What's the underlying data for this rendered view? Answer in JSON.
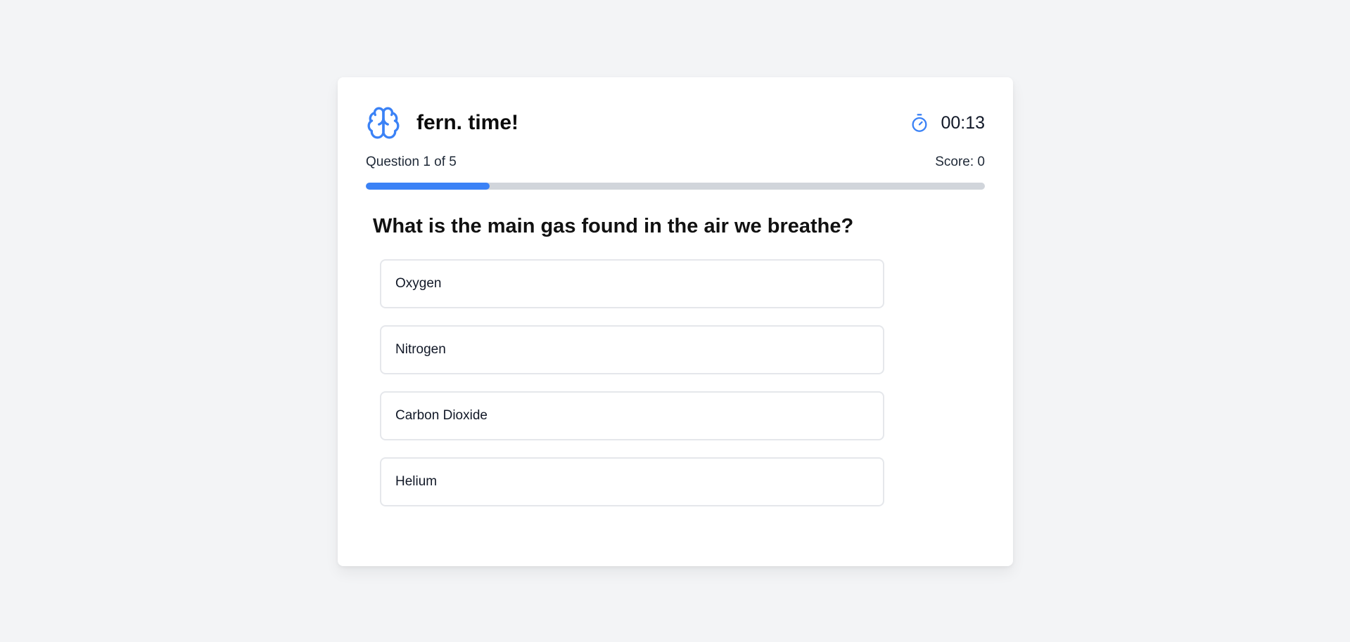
{
  "app": {
    "title": "fern. time!",
    "brand_icon": "brain-icon"
  },
  "timer": {
    "icon": "stopwatch-icon",
    "value": "00:13"
  },
  "progress": {
    "question_label": "Question 1 of 5",
    "score_label": "Score: 0",
    "fraction": 0.2
  },
  "question": {
    "text": "What is the main gas found in the air we breathe?"
  },
  "options": [
    {
      "label": "Oxygen"
    },
    {
      "label": "Nitrogen"
    },
    {
      "label": "Carbon Dioxide"
    },
    {
      "label": "Helium"
    }
  ],
  "colors": {
    "accent": "#3b82f6",
    "background": "#f3f4f6",
    "card": "#ffffff",
    "track": "#d1d5db",
    "option_border": "#e5e7eb"
  }
}
